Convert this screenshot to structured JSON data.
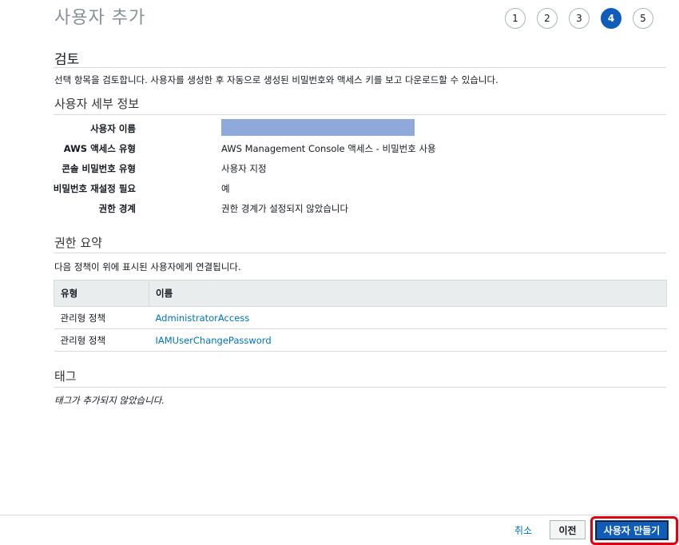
{
  "page_title": "사용자 추가",
  "steps": [
    {
      "label": "1",
      "active": false
    },
    {
      "label": "2",
      "active": false
    },
    {
      "label": "3",
      "active": false
    },
    {
      "label": "4",
      "active": true
    },
    {
      "label": "5",
      "active": false
    }
  ],
  "review": {
    "heading": "검토",
    "description": "선택 항목을 검토합니다. 사용자를 생성한 후 자동으로 생성된 비밀번호와 액세스 키를 보고 다운로드할 수 있습니다."
  },
  "user_details": {
    "heading": "사용자 세부 정보",
    "rows": [
      {
        "label": "사용자 이름",
        "value": ""
      },
      {
        "label": "AWS 액세스 유형",
        "value": "AWS Management Console 액세스 - 비밀번호 사용"
      },
      {
        "label": "콘솔 비밀번호 유형",
        "value": "사용자 지정"
      },
      {
        "label": "비밀번호 재설정 필요",
        "value": "예"
      },
      {
        "label": "권한 경계",
        "value": "권한 경계가 설정되지 않았습니다"
      }
    ]
  },
  "permissions": {
    "heading": "권한 요약",
    "description": "다음 정책이 위에 표시된 사용자에게 연결됩니다.",
    "columns": [
      "유형",
      "이름"
    ],
    "rows": [
      {
        "type": "관리형 정책",
        "name": "AdministratorAccess"
      },
      {
        "type": "관리형 정책",
        "name": "IAMUserChangePassword"
      }
    ]
  },
  "tags": {
    "heading": "태그",
    "empty_text": "태그가 추가되지 않았습니다."
  },
  "footer": {
    "cancel_label": "취소",
    "previous_label": "이전",
    "create_label": "사용자 만들기"
  }
}
